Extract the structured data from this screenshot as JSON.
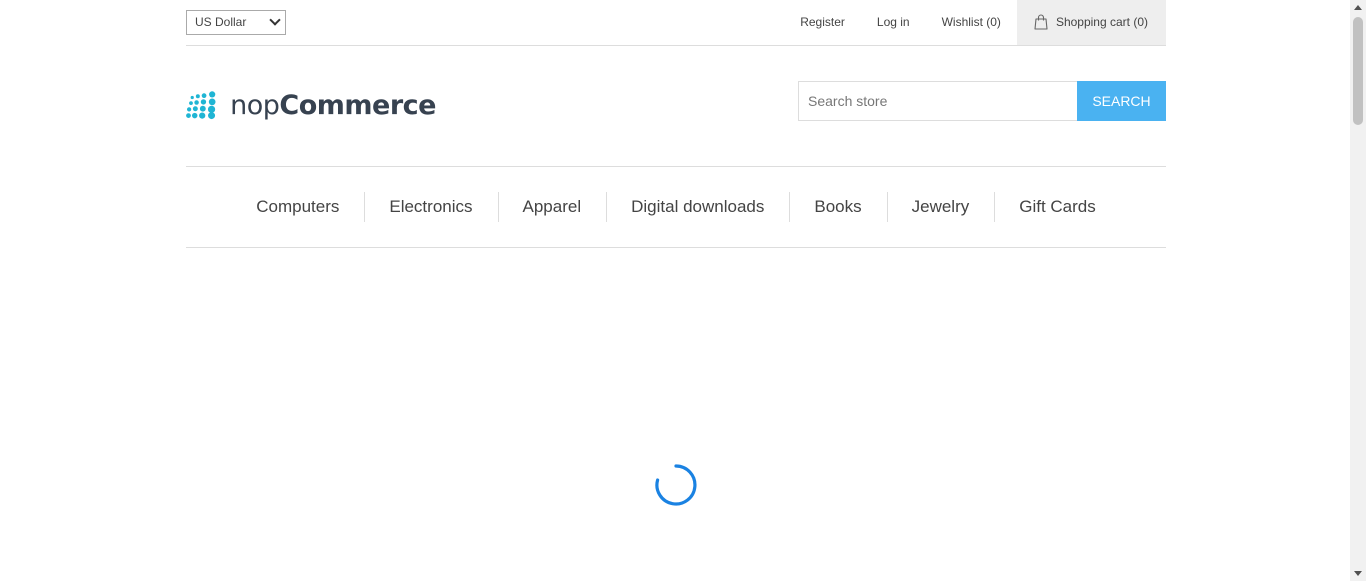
{
  "currency": {
    "selected": "US Dollar"
  },
  "header_links": {
    "register": "Register",
    "login": "Log in",
    "wishlist": "Wishlist (0)",
    "cart": "Shopping cart (0)"
  },
  "logo": {
    "part1": "nop",
    "part2": "Commerce",
    "dot_color": "#1fb5d4"
  },
  "search": {
    "placeholder": "Search store",
    "button_label": "Search"
  },
  "menu": {
    "items": [
      "Computers",
      "Electronics",
      "Apparel",
      "Digital downloads",
      "Books",
      "Jewelry",
      "Gift Cards"
    ]
  },
  "colors": {
    "accent": "#4ab2f1",
    "spinner": "#1a82e2"
  },
  "icons": {
    "cart": "shopping-bag-icon",
    "loading": "spinner-icon"
  }
}
